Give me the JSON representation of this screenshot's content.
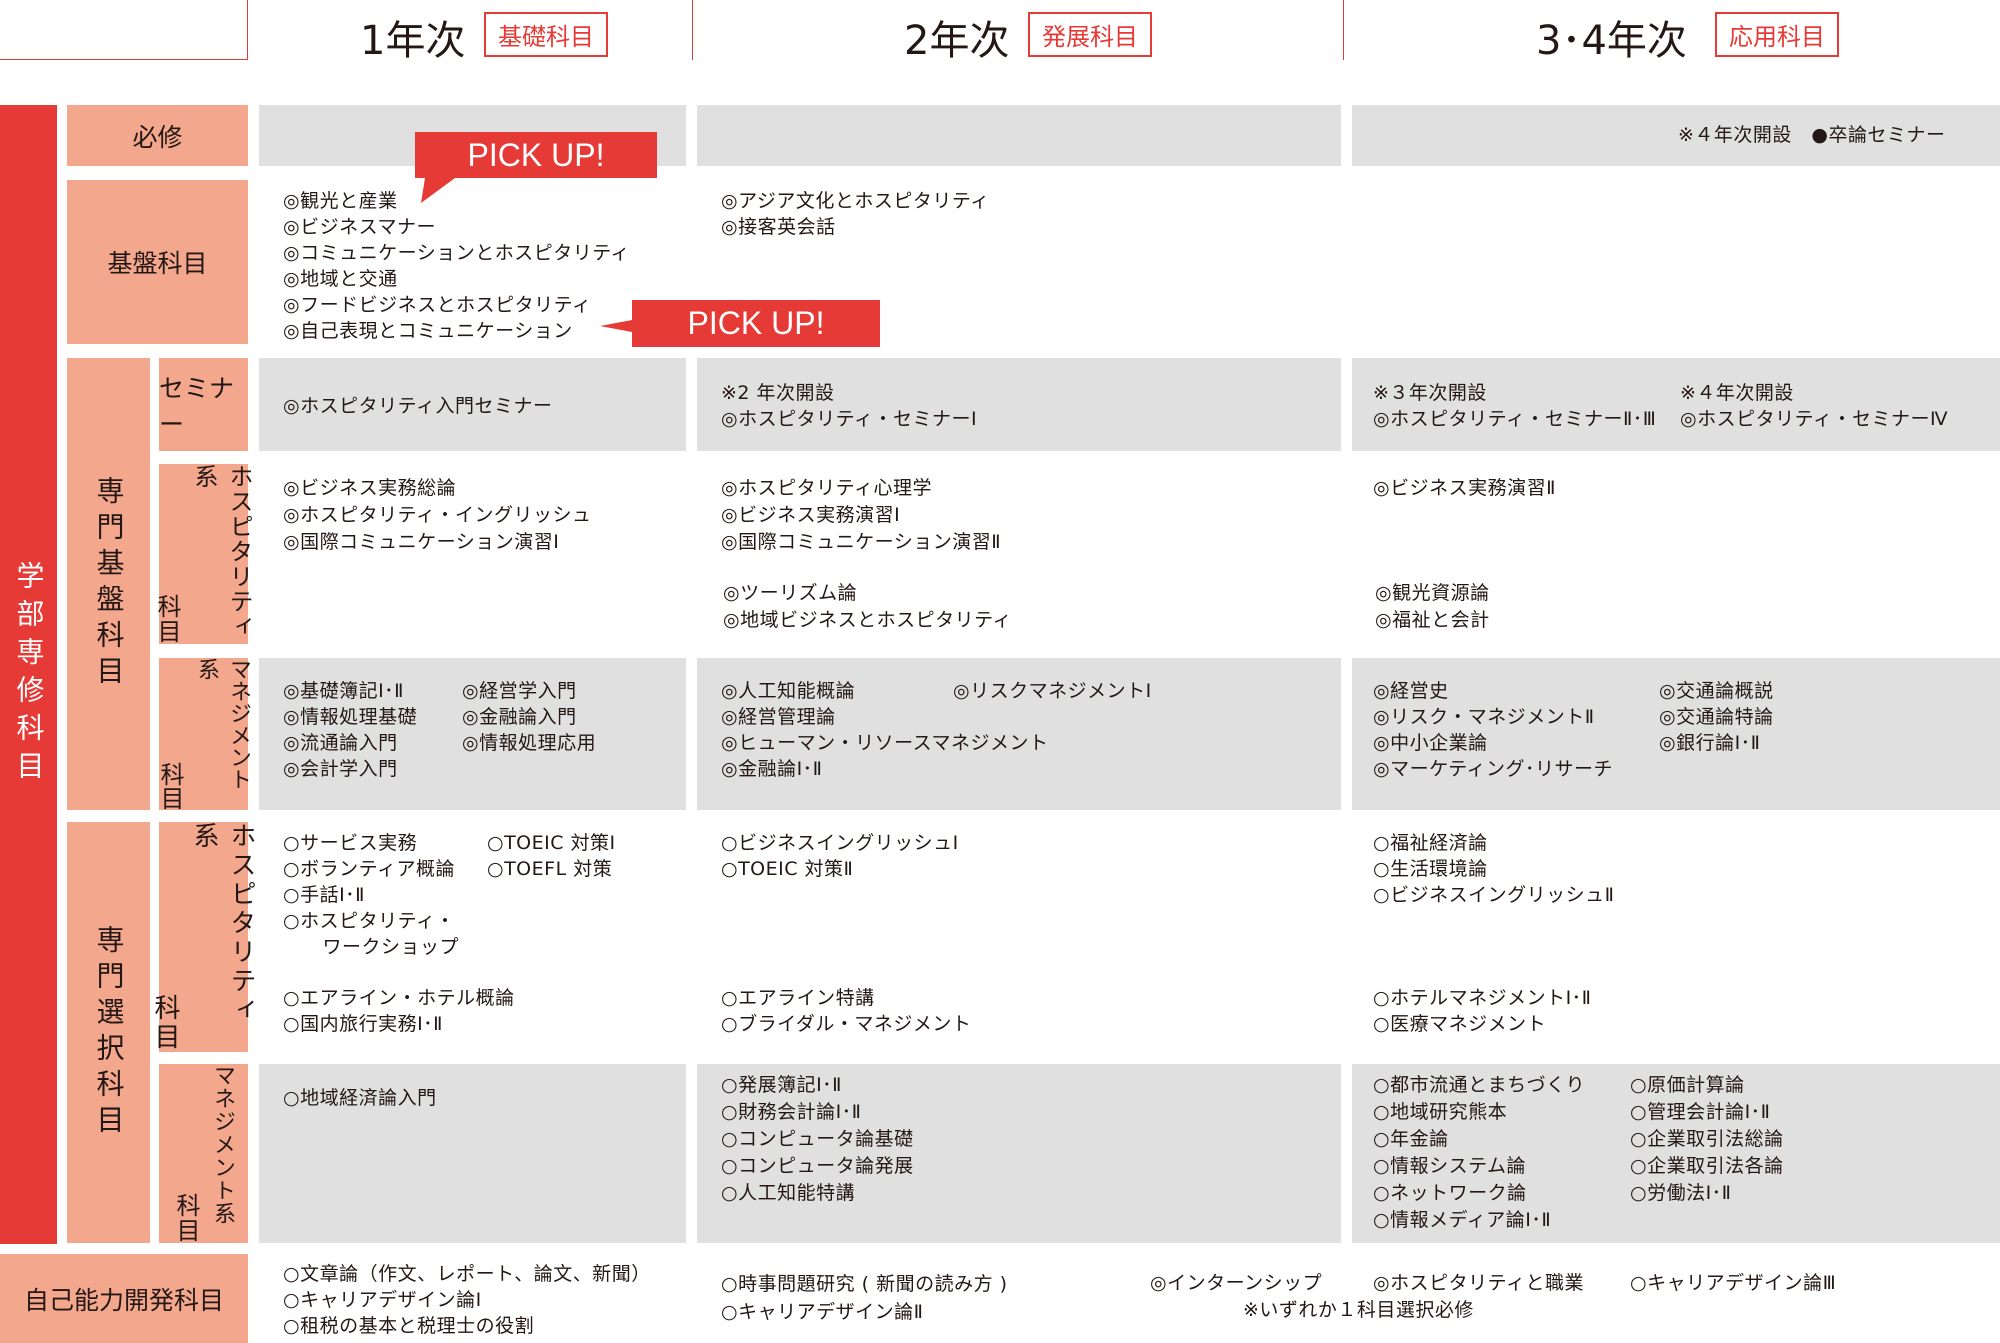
{
  "header": {
    "year1": {
      "title": "1年次",
      "tag": "基礎科目"
    },
    "year2": {
      "title": "2年次",
      "tag": "発展科目"
    },
    "year34": {
      "title": "3･4年次",
      "tag": "応用科目"
    }
  },
  "categories": {
    "faculty_major": "学部専修科目",
    "required": "必修",
    "foundation": "基盤科目",
    "specialty_foundation": "専門基盤科目",
    "specialty_elective": "専門選択科目",
    "seminar": "セミナー",
    "hospitality_line1": "ホスピタリティ系",
    "hospitality_line2": "科目",
    "management_line1": "マネジメント系",
    "management_line2": "科目",
    "self_dev": "自己能力開発科目"
  },
  "pickup": {
    "label": "PICK UP!"
  },
  "required_row": {
    "note": "※４年次開設　●卒論セミナー"
  },
  "foundation_row": {
    "y1": [
      "◎観光と産業",
      "◎ビジネスマナー",
      "◎コミュニケーションとホスピタリティ",
      "◎地域と交通",
      "◎フードビジネスとホスピタリティ",
      "◎自己表現とコミュニケーション"
    ],
    "y2": [
      "◎アジア文化とホスピタリティ",
      "◎接客英会話"
    ]
  },
  "seminar_row": {
    "y1": [
      "◎ホスピタリティ入門セミナー"
    ],
    "y2": [
      "※2 年次開設",
      "◎ホスピタリティ・セミナーⅠ"
    ],
    "y3": [
      "※３年次開設",
      "◎ホスピタリティ・セミナーⅡ･Ⅲ"
    ],
    "y4": [
      "※４年次開設",
      "◎ホスピタリティ・セミナーⅣ"
    ]
  },
  "sf_hospitality": {
    "y1": [
      "◎ビジネス実務総論",
      "◎ホスピタリティ・イングリッシュ",
      "◎国際コミュニケーション演習Ⅰ"
    ],
    "y2a": [
      "◎ホスピタリティ心理学",
      "◎ビジネス実務演習Ⅰ",
      "◎国際コミュニケーション演習Ⅱ"
    ],
    "y2b": [
      "◎ツーリズム論",
      "◎地域ビジネスとホスピタリティ"
    ],
    "y3a": [
      "◎ビジネス実務演習Ⅱ"
    ],
    "y3b": [
      "◎観光資源論",
      "◎福祉と会計"
    ]
  },
  "sf_management": {
    "y1a": [
      "◎基礎簿記Ⅰ･Ⅱ",
      "◎情報処理基礎",
      "◎流通論入門",
      "◎会計学入門"
    ],
    "y1b": [
      "◎経営学入門",
      "◎金融論入門",
      "◎情報処理応用"
    ],
    "y2a": [
      "◎人工知能概論",
      "◎経営管理論",
      "◎ヒューマン・リソースマネジメント",
      "◎金融論Ⅰ･Ⅱ"
    ],
    "y2b": [
      "◎リスクマネジメントⅠ"
    ],
    "y3a": [
      "◎経営史",
      "◎リスク・マネジメントⅡ",
      "◎中小企業論",
      "◎マーケティング･リサーチ"
    ],
    "y3b": [
      "◎交通論概説",
      "◎交通論特論",
      "◎銀行論Ⅰ･Ⅱ"
    ]
  },
  "se_hospitality": {
    "y1a": [
      "○サービス実務",
      "○ボランティア概論",
      "○手話Ⅰ･Ⅱ",
      "○ホスピタリティ・",
      "　ワークショップ"
    ],
    "y1b": [
      "○TOEIC 対策Ⅰ",
      "○TOEFL 対策"
    ],
    "y1c": [
      "○エアライン・ホテル概論",
      "○国内旅行実務Ⅰ･Ⅱ"
    ],
    "y2a": [
      "○ビジネスイングリッシュⅠ",
      "○TOEIC 対策Ⅱ"
    ],
    "y2b": [
      "○エアライン特講",
      "○ブライダル・マネジメント"
    ],
    "y3a": [
      "○福祉経済論",
      "○生活環境論",
      "○ビジネスイングリッシュⅡ"
    ],
    "y3b": [
      "○ホテルマネジメントⅠ･Ⅱ",
      "○医療マネジメント"
    ]
  },
  "se_management": {
    "y1": [
      "○地域経済論入門"
    ],
    "y2": [
      "○発展簿記Ⅰ･Ⅱ",
      "○財務会計論Ⅰ･Ⅱ",
      "○コンピュータ論基礎",
      "○コンピュータ論発展",
      "○人工知能特講"
    ],
    "y3a": [
      "○都市流通とまちづくり",
      "○地域研究熊本",
      "○年金論",
      "○情報システム論",
      "○ネットワーク論",
      "○情報メディア論Ⅰ･Ⅱ"
    ],
    "y3b": [
      "○原価計算論",
      "○管理会計論Ⅰ･Ⅱ",
      "○企業取引法総論",
      "○企業取引法各論",
      "○労働法Ⅰ･Ⅱ"
    ]
  },
  "self_dev_row": {
    "y1": [
      "○文章論（作文、レポート、論文、新聞）",
      "○キャリアデザイン論Ⅰ",
      "○租税の基本と税理士の役割"
    ],
    "y2": [
      "○時事問題研究 ( 新聞の読み方 )",
      "○キャリアデザイン論Ⅱ"
    ],
    "y3": {
      "a": "◎インターンシップ",
      "b": "◎ホスピタリティと職業",
      "c": "○キャリアデザイン論Ⅲ",
      "note": "※いずれか１科目選択必修"
    }
  }
}
